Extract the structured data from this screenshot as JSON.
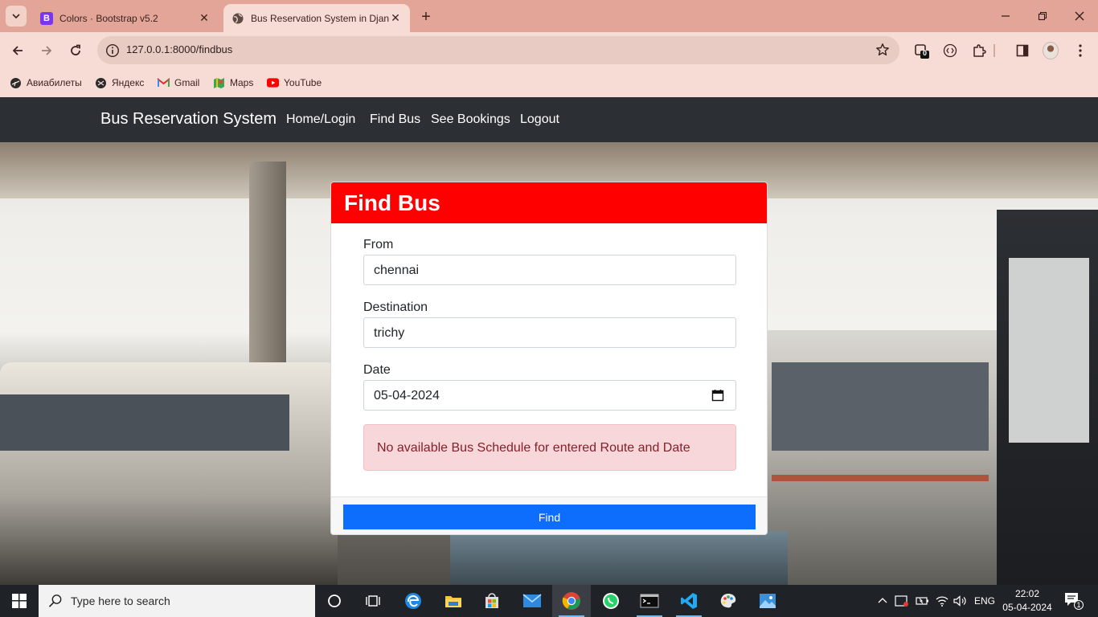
{
  "browser": {
    "tabs": [
      {
        "title": "Colors · Bootstrap v5.2",
        "favicon": "bootstrap-icon",
        "active": false
      },
      {
        "title": "Bus Reservation System in Djan",
        "favicon": "globe-icon",
        "active": true
      }
    ],
    "url": "127.0.0.1:8000/findbus",
    "extension_badge": "0",
    "bookmarks": [
      {
        "label": "Авиабилеты",
        "icon": "aviabilety-icon"
      },
      {
        "label": "Яндекс",
        "icon": "yandex-icon"
      },
      {
        "label": "Gmail",
        "icon": "gmail-icon"
      },
      {
        "label": "Maps",
        "icon": "maps-icon"
      },
      {
        "label": "YouTube",
        "icon": "youtube-icon"
      }
    ]
  },
  "navbar": {
    "brand": "Bus Reservation System",
    "links": [
      "Home/Login",
      "Find Bus",
      "See Bookings",
      "Logout"
    ]
  },
  "form": {
    "title": "Find Bus",
    "from_label": "From",
    "from_value": "chennai",
    "destination_label": "Destination",
    "destination_value": "trichy",
    "date_label": "Date",
    "date_value": "05-04-2024",
    "alert": "No available Bus Schedule for entered Route and Date",
    "submit_label": "Find"
  },
  "taskbar": {
    "search_placeholder": "Type here to search",
    "language": "ENG",
    "time": "22:02",
    "date": "05-04-2024",
    "notification_count": "1"
  },
  "colors": {
    "header_red": "#ff0000",
    "button_blue": "#0d6efd",
    "navbar_dark": "#2c3034",
    "alert_bg": "#f8d7da",
    "alert_text": "#842029"
  }
}
